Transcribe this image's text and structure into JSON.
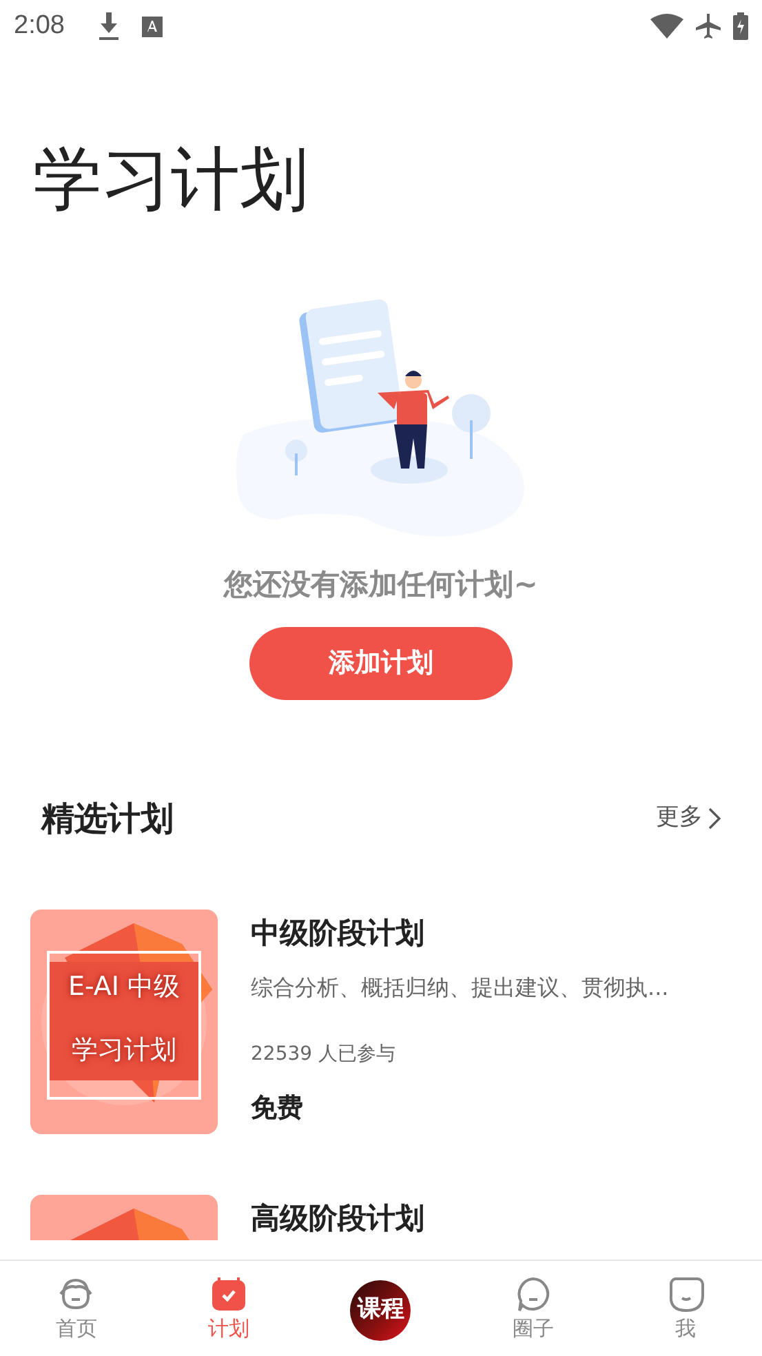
{
  "status_bar": {
    "time": "2:08"
  },
  "page_title": "学习计划",
  "empty_state": {
    "message": "您还没有添加任何计划~",
    "button": "添加计划"
  },
  "section": {
    "title": "精选计划",
    "more": "更多"
  },
  "plans": [
    {
      "cover_lines": [
        "E-AI 中级",
        "学习计划"
      ],
      "title": "中级阶段计划",
      "description": "综合分析、概括归纳、提出建议、贯彻执...",
      "participants": "22539 人已参与",
      "price": "免费"
    },
    {
      "title": "高级阶段计划"
    }
  ],
  "tabs": [
    {
      "label": "首页",
      "kind": "face",
      "selected": false
    },
    {
      "label": "计划",
      "kind": "calendar",
      "selected": true
    },
    {
      "label": "课程",
      "kind": "center",
      "selected": false
    },
    {
      "label": "圈子",
      "kind": "bubble",
      "selected": false
    },
    {
      "label": "我",
      "kind": "smile",
      "selected": false
    }
  ]
}
